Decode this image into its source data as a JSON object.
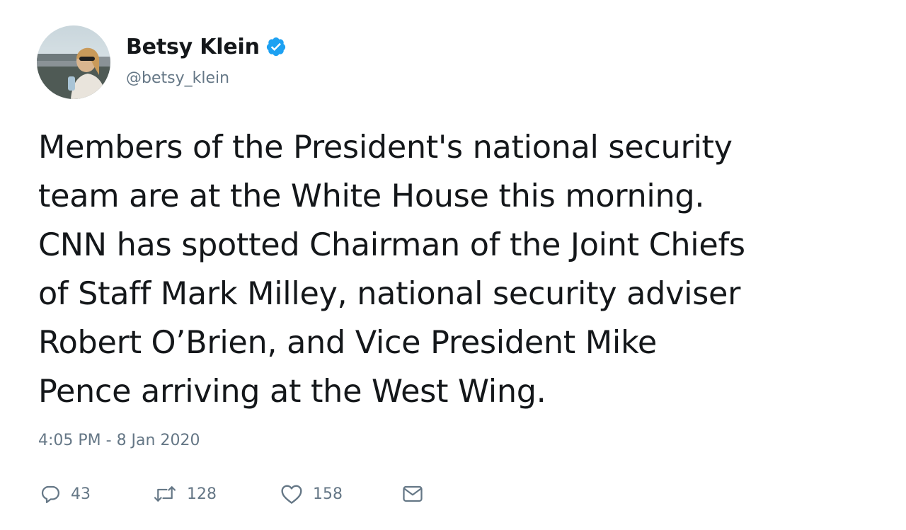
{
  "author": {
    "display_name": "Betsy Klein",
    "handle": "@betsy_klein",
    "verified": true
  },
  "tweet": {
    "text": "Members of the President's national security\nteam are at the White House this morning.\nCNN has spotted Chairman of the Joint Chiefs\nof Staff Mark Milley, national security adviser\nRobert O’Brien, and Vice President Mike\nPence arriving at the West Wing.",
    "timestamp": "4:05 PM - 8 Jan 2020"
  },
  "actions": {
    "replies": "43",
    "retweets": "128",
    "likes": "158"
  },
  "icons": {
    "verified": "verified-badge-icon",
    "reply": "reply-icon",
    "retweet": "retweet-icon",
    "like": "heart-icon",
    "dm": "envelope-icon"
  },
  "colors": {
    "text": "#14171a",
    "secondary": "#657786",
    "verified": "#1da1f2"
  }
}
